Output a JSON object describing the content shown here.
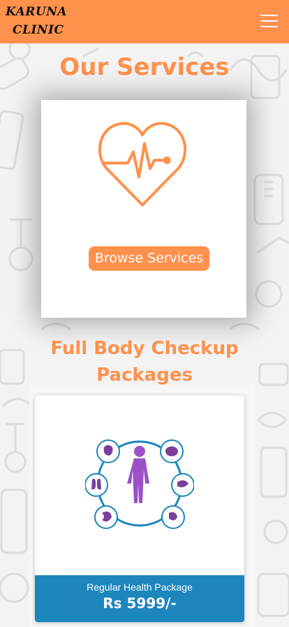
{
  "brand": {
    "line1": "KARUNA",
    "line2": "CLINIC"
  },
  "nav": {
    "menu_icon": "hamburger-menu-icon"
  },
  "services": {
    "title": "Our Services",
    "card_icon": "heart-pulse-icon",
    "button_label": "Browse Services"
  },
  "packages": {
    "title": "Full Body Checkup Packages",
    "items": [
      {
        "name": "Regular Health Package",
        "price": "Rs 5999/-",
        "icon": "human-body-organs-icon"
      }
    ]
  },
  "colors": {
    "accent": "#ff914d",
    "package_footer": "#1c86bd",
    "background": "#f3f3f3"
  }
}
